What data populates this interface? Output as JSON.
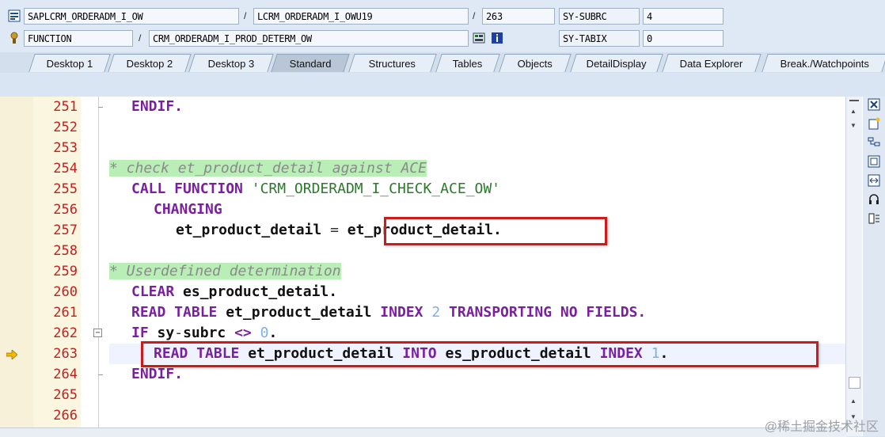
{
  "header": {
    "program": "SAPLCRM_ORDERADM_I_OW",
    "include": "LCRM_ORDERADM_I_OWU19",
    "line": "263",
    "sysvar1_name": "SY-SUBRC",
    "sysvar1_value": "4",
    "type": "FUNCTION",
    "routine": "CRM_ORDERADM_I_PROD_DETERM_OW",
    "sysvar2_name": "SY-TABIX",
    "sysvar2_value": "0"
  },
  "tabs": [
    "Desktop 1",
    "Desktop 2",
    "Desktop 3",
    "Standard",
    "Structures",
    "Tables",
    "Objects",
    "DetailDisplay",
    "Data Explorer",
    "Break./Watchpoints"
  ],
  "active_tab": "Standard",
  "code": {
    "line_numbers": [
      "251",
      "252",
      "253",
      "254",
      "255",
      "256",
      "257",
      "258",
      "259",
      "260",
      "261",
      "262",
      "263",
      "264",
      "265",
      "266"
    ],
    "l251": "ENDIF.",
    "l254": "* check et_product_detail against ACE",
    "l255_kw": "CALL FUNCTION",
    "l255_str": "'CRM_ORDERADM_I_CHECK_ACE_OW'",
    "l256": "CHANGING",
    "l257_a": "et_product_detail",
    "l257_op": "=",
    "l257_b": "et_product_detail.",
    "l259": "* Userdefined determination",
    "l260_kw": "CLEAR",
    "l260_id": "es_product_detail.",
    "l261_kw1": "READ TABLE",
    "l261_id": "et_product_detail",
    "l261_kw2": "INDEX",
    "l261_num": "2",
    "l261_kw3": "TRANSPORTING NO FIELDS.",
    "l262_kw": "IF",
    "l262_id1": "sy",
    "l262_op1": "-",
    "l262_id2": "subrc",
    "l262_op2": "<>",
    "l262_num": "0",
    "l262_end": ".",
    "l263_kw1": "READ TABLE",
    "l263_id1": "et_product_detail",
    "l263_kw2": "INTO",
    "l263_id2": "es_product_detail",
    "l263_kw3": "INDEX",
    "l263_num": "1",
    "l263_end": ".",
    "l264": "ENDIF."
  },
  "watermark": "@稀土掘金技术社区",
  "colors": {
    "keyword": "#7a1fa0",
    "string": "#2a7a2a",
    "number": "#7fb0e0",
    "comment_bg": "#b9eeb7",
    "line_number": "#c02020",
    "highlight_box": "#cc1b1b"
  }
}
